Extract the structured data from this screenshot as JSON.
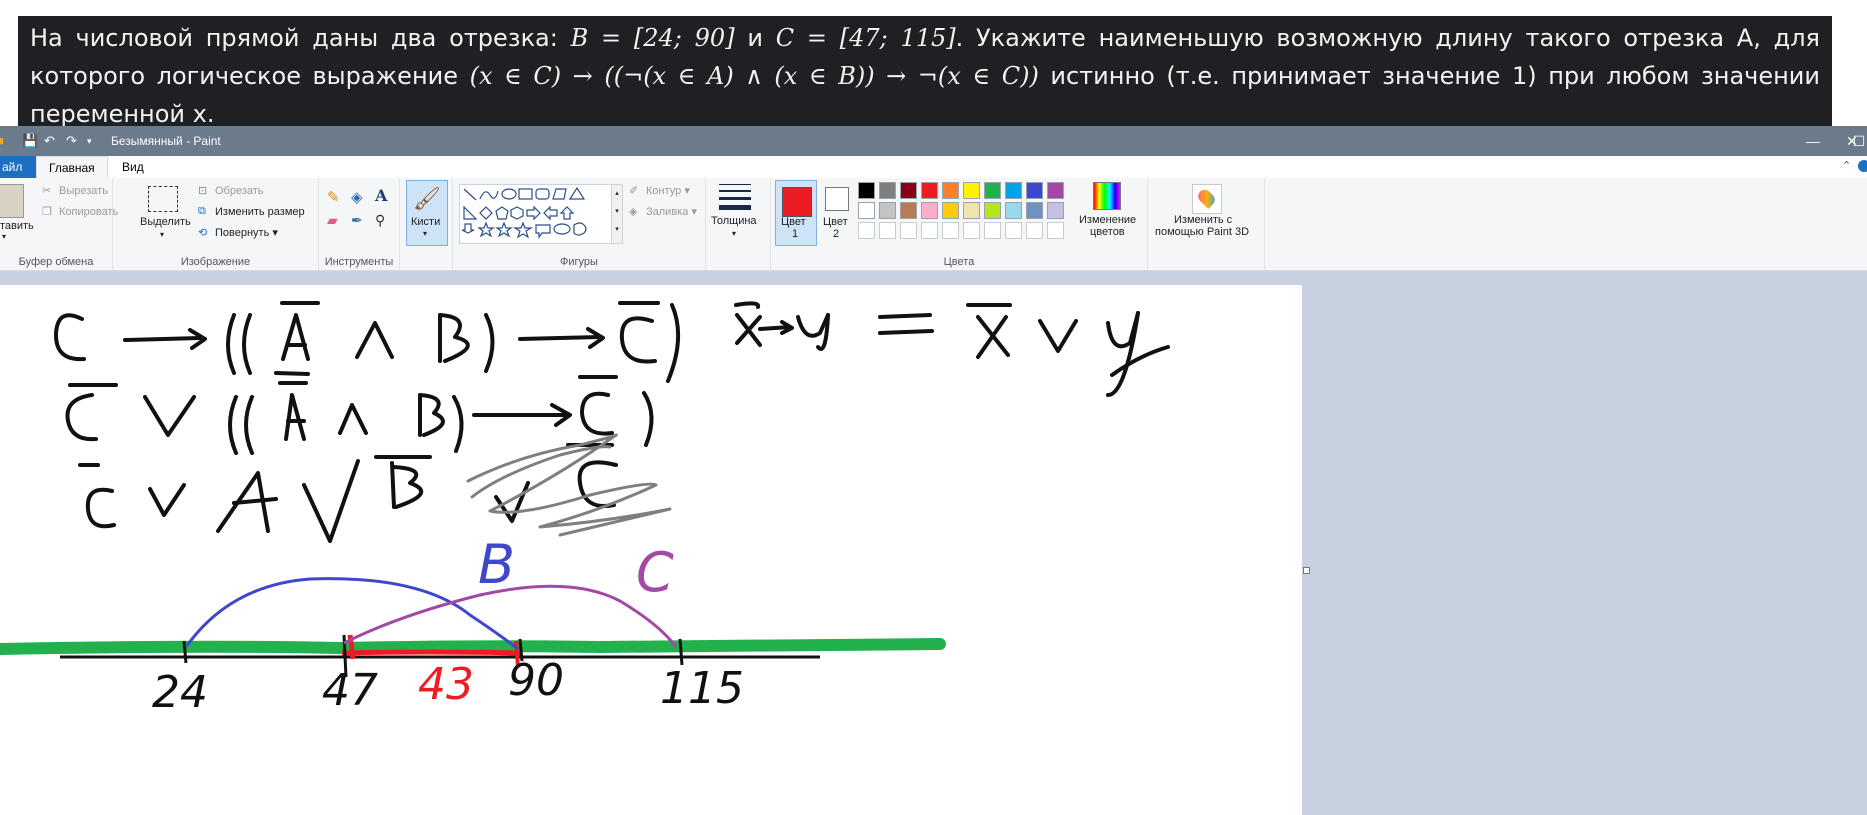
{
  "problem": {
    "line1_a": "На числовой прямой даны два отрезка: ",
    "line1_b": "B = [24; 90]",
    "line1_c": " и ",
    "line1_d": "C = [47; 115]",
    "line1_e": ". Укажите наименьшую возможную длину такого отрезка А, для которого",
    "line2_a": "логическое выражение ",
    "line2_b": "(x ∈ C) → ((¬(x ∈ A) ∧ (x ∈ B)) → ¬(x ∈ C))",
    "line2_c": " истинно (т.е. принимает значение 1) при любом значении",
    "line3": "переменной x."
  },
  "window": {
    "title": "Безымянный - Paint",
    "minimize": "—",
    "maximize": "☐",
    "close": "✕"
  },
  "tabs": {
    "file": "айл",
    "home": "Главная",
    "view": "Вид"
  },
  "ribbon": {
    "clipboard": {
      "paste": "тавить",
      "cut": "Вырезать",
      "copy": "Копировать",
      "label": "Буфер обмена"
    },
    "image": {
      "select": "Выделить",
      "crop": "Обрезать",
      "resize": "Изменить размер",
      "rotate": "Повернуть",
      "label": "Изображение"
    },
    "tools": {
      "label": "Инструменты"
    },
    "brushes": {
      "label": "Кисти"
    },
    "shapes": {
      "outline": "Контур",
      "fill": "Заливка",
      "label": "Фигуры"
    },
    "thickness": {
      "label": "Толщина"
    },
    "colors": {
      "color1": "Цвет",
      "color1_n": "1",
      "color2": "Цвет",
      "color2_n": "2",
      "edit": "Изменение",
      "edit2": "цветов",
      "label": "Цвета",
      "color1_value": "#ed1c24",
      "color2_value": "#ffffff",
      "palette_row1": [
        "#000000",
        "#7f7f7f",
        "#880015",
        "#ed1c24",
        "#ff7f27",
        "#fff200",
        "#22b14c",
        "#00a2e8",
        "#3f48cc",
        "#a349a4"
      ],
      "palette_row2": [
        "#ffffff",
        "#c3c3c3",
        "#b97a57",
        "#ffaec9",
        "#ffc90e",
        "#efe4b0",
        "#b5e61d",
        "#99d9ea",
        "#7092be",
        "#c8bfe7"
      ]
    },
    "paint3d": {
      "line1": "Изменить с",
      "line2": "помощью Paint 3D"
    }
  },
  "drawing": {
    "labels": {
      "b": "B",
      "c": "C",
      "n24": "24",
      "n47": "47",
      "n43": "43",
      "n90": "90",
      "n115": "115"
    }
  }
}
